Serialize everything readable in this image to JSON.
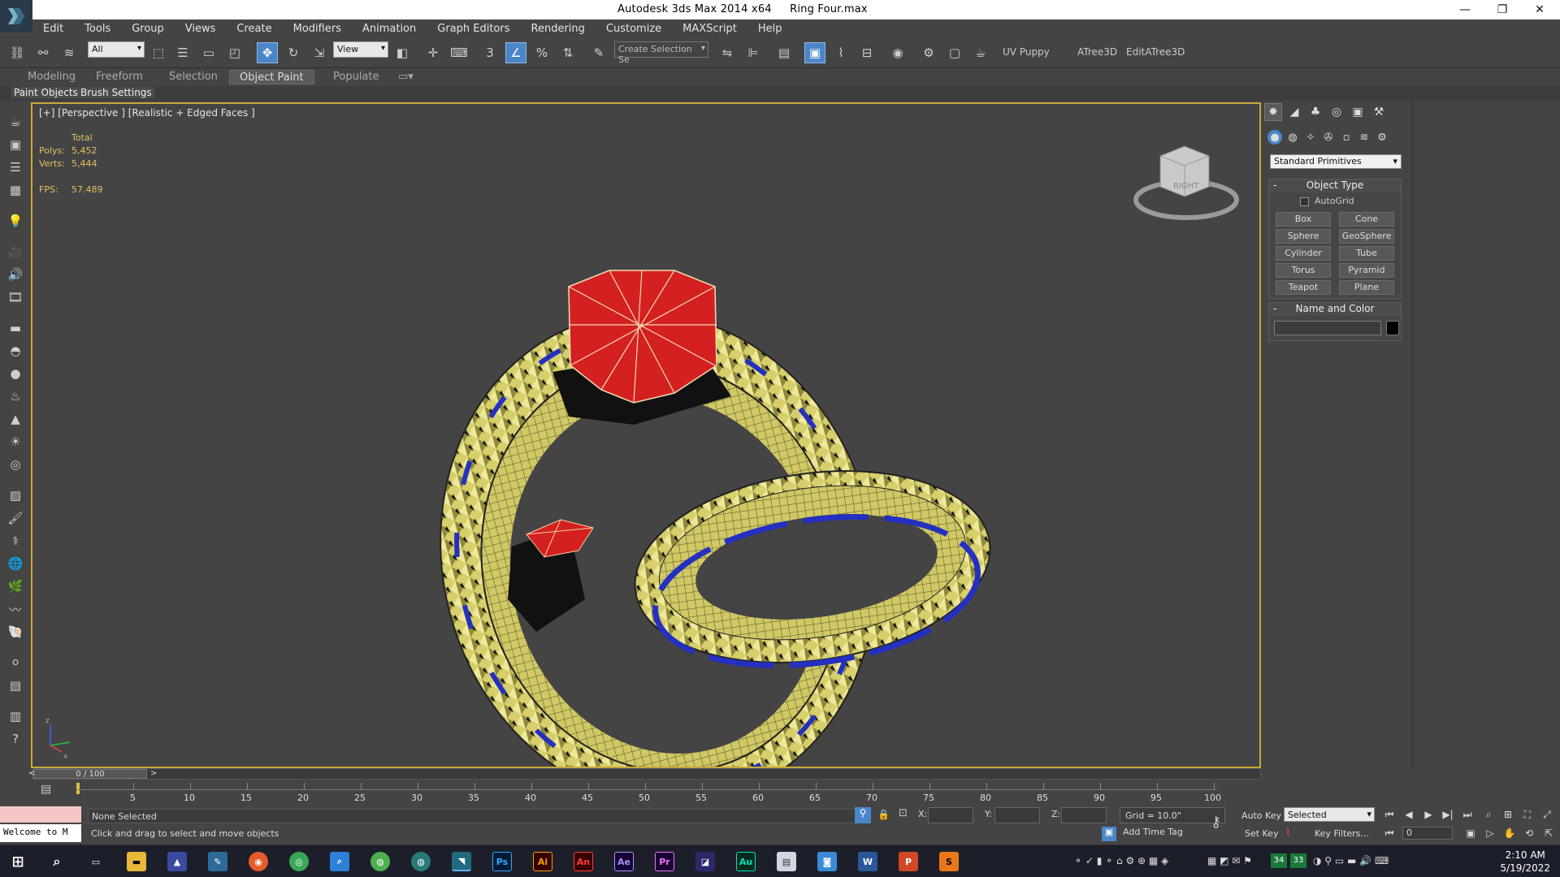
{
  "window": {
    "app_title": "Autodesk 3ds Max  2014 x64",
    "file_title": "Ring Four.max",
    "minimize": "—",
    "restore": "❐",
    "close": "✕"
  },
  "menu": [
    "Edit",
    "Tools",
    "Group",
    "Views",
    "Create",
    "Modifiers",
    "Animation",
    "Graph Editors",
    "Rendering",
    "Customize",
    "MAXScript",
    "Help"
  ],
  "toolbar": {
    "selection_filter": "All",
    "ref_coord": "View",
    "named_selection": "Create Selection Se",
    "snap_3": "3",
    "snap_pct": "%",
    "plugins": [
      "UV Puppy",
      "ATree3D",
      "EditATree3D"
    ]
  },
  "ribbon": {
    "tabs": [
      "Modeling",
      "Freeform",
      "Selection",
      "Object Paint",
      "Populate"
    ],
    "active_tab": "Object Paint",
    "sub": [
      "Paint Objects",
      "Brush Settings"
    ]
  },
  "viewport": {
    "label": "[+] [Perspective ] [Realistic + Edged Faces ]",
    "stats_total": "Total",
    "polys_label": "Polys:",
    "polys_value": "5,452",
    "verts_label": "Verts:",
    "verts_value": "5,444",
    "fps_label": "FPS:",
    "fps_value": "57.489",
    "viewcube_face": "RIGHT",
    "axis_z": "z",
    "axis_x": "x"
  },
  "command_panel": {
    "category": "Standard Primitives",
    "object_type_title": "Object Type",
    "autogrid_label": "AutoGrid",
    "primitives": [
      "Box",
      "Cone",
      "Sphere",
      "GeoSphere",
      "Cylinder",
      "Tube",
      "Torus",
      "Pyramid",
      "Teapot",
      "Plane"
    ],
    "name_color_title": "Name and Color",
    "object_color": "#000000"
  },
  "timeline": {
    "frame_indicator": "0 / 100",
    "ticks": [
      "5",
      "10",
      "15",
      "20",
      "25",
      "30",
      "35",
      "40",
      "45",
      "50",
      "55",
      "60",
      "65",
      "70",
      "75",
      "80",
      "85",
      "90",
      "95",
      "100"
    ]
  },
  "status": {
    "selection": "None Selected",
    "prompt": "Click and drag to select and move objects",
    "listener": "Welcome to M",
    "x_label": "X:",
    "y_label": "Y:",
    "z_label": "Z:",
    "grid": "Grid = 10.0\"",
    "add_time_tag": "Add Time Tag",
    "auto_key": "Auto Key",
    "set_key": "Set Key",
    "key_mode": "Selected",
    "key_filters": "Key Filters...",
    "current_frame": "0"
  },
  "taskbar": {
    "apps": [
      "Ps",
      "Ai",
      "An",
      "Ae",
      "Pr",
      "Au",
      "W",
      "P"
    ],
    "tray_nums": [
      "34",
      "33"
    ],
    "time": "2:10 AM",
    "date": "5/19/2022"
  },
  "colors": {
    "viewport_border": "#c8a83a",
    "gem_red": "#d42020",
    "band_gold": "#d8d070",
    "band_blue": "#2430c0",
    "active_tool": "#4a86c8"
  }
}
